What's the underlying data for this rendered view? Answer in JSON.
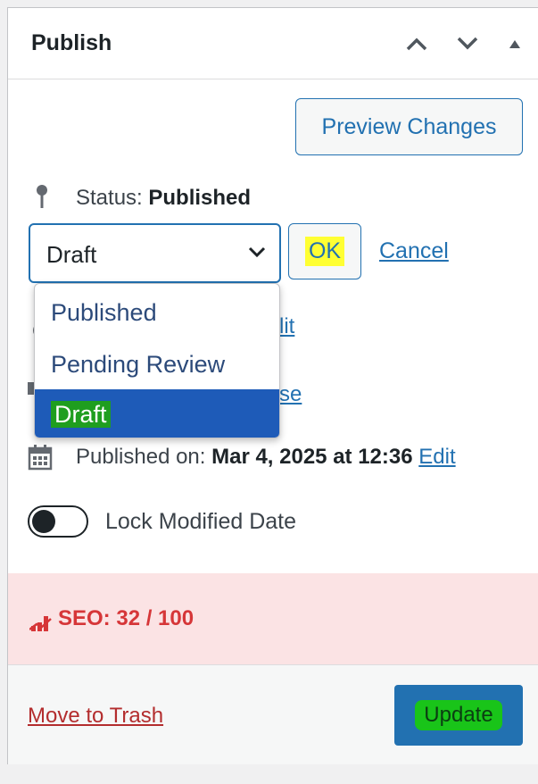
{
  "panel": {
    "title": "Publish",
    "header_buttons": [
      "move-up",
      "move-down",
      "collapse"
    ]
  },
  "preview_button": "Preview Changes",
  "status": {
    "label": "Status: ",
    "value": "Published",
    "selected": "Draft",
    "ok_label": "OK",
    "cancel_label": "Cancel",
    "options": [
      "Published",
      "Pending Review",
      "Draft"
    ],
    "selected_index": 2
  },
  "hidden_rows": {
    "visibility_edit_fragment": "lit",
    "revisions_browse_fragment": "se"
  },
  "published_on": {
    "label": "Published on: ",
    "value": "Mar 4, 2025 at 12:36",
    "edit_label": "Edit"
  },
  "lock_modified": {
    "label": "Lock Modified Date",
    "enabled": false
  },
  "seo": {
    "text": "SEO: 32 / 100",
    "color": "#d63638"
  },
  "footer": {
    "trash_label": "Move to Trash",
    "update_label": "Update"
  },
  "colors": {
    "accent": "#2271b1",
    "dropdown_selected": "#1e5bb8",
    "highlight_yellow": "#ffff33",
    "highlight_green": "#19c419",
    "seo_background": "#fbe3e4"
  }
}
